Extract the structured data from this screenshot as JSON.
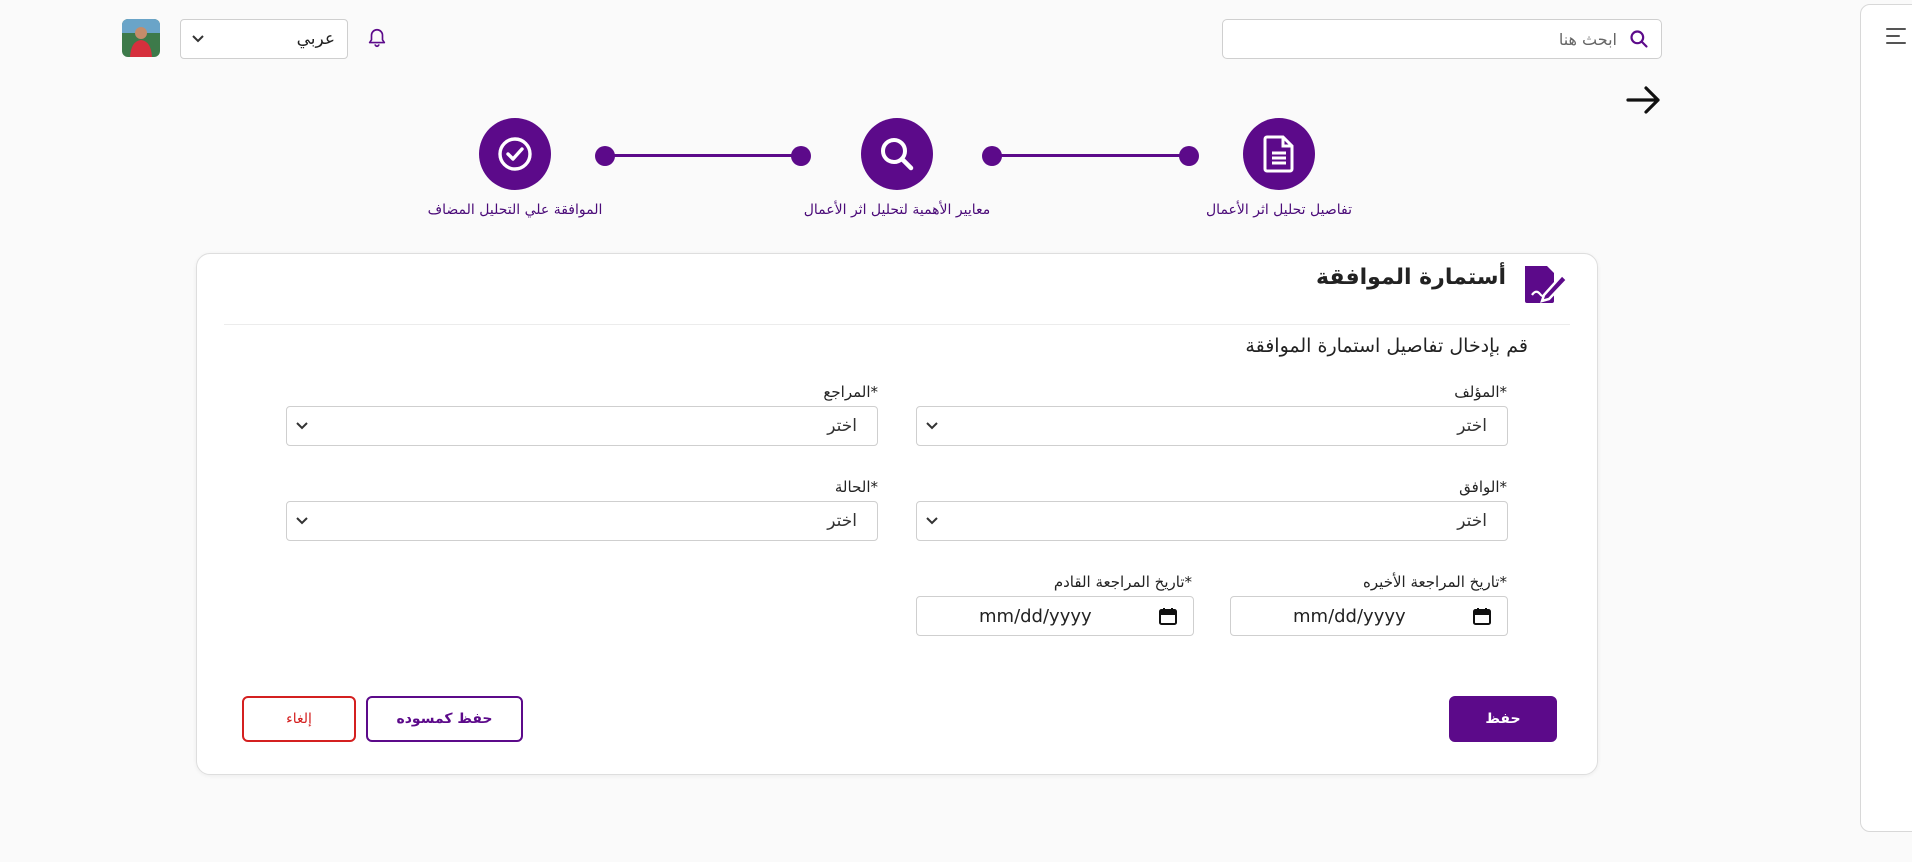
{
  "header": {
    "language": "عربي",
    "search_placeholder": "ابحث هنا"
  },
  "stepper": {
    "steps": [
      {
        "label": "تفاصيل تحليل اثر الأعمال",
        "icon": "document-icon"
      },
      {
        "label": "معايير الأهمية لتحليل اثر الأعمال",
        "icon": "search-icon"
      },
      {
        "label": "الموافقة علي التحليل المضاف",
        "icon": "check-circle-icon"
      }
    ]
  },
  "form": {
    "title": "أستمارة الموافقة",
    "subtitle": "قم بإدخال تفاصيل استمارة الموافقة",
    "fields": {
      "author_label": "*المؤلف",
      "author_value": "اختر",
      "reviewer_label": "*المراجع",
      "reviewer_value": "اختر",
      "approver_label": "*الوافق",
      "approver_value": "اختر",
      "status_label": "*الحالة",
      "status_value": "اختر",
      "last_review_label": "*تاريخ المراجعة الأخيره",
      "last_review_value": "mm/dd/yyyy",
      "next_review_label": "*تاريخ المراجعة القادم",
      "next_review_value": "mm/dd/yyyy"
    },
    "buttons": {
      "save": "حفظ",
      "save_draft": "حفظ كمسوده",
      "cancel": "إلغاء"
    }
  },
  "colors": {
    "primary": "#5c0a8a",
    "danger": "#d42020"
  }
}
